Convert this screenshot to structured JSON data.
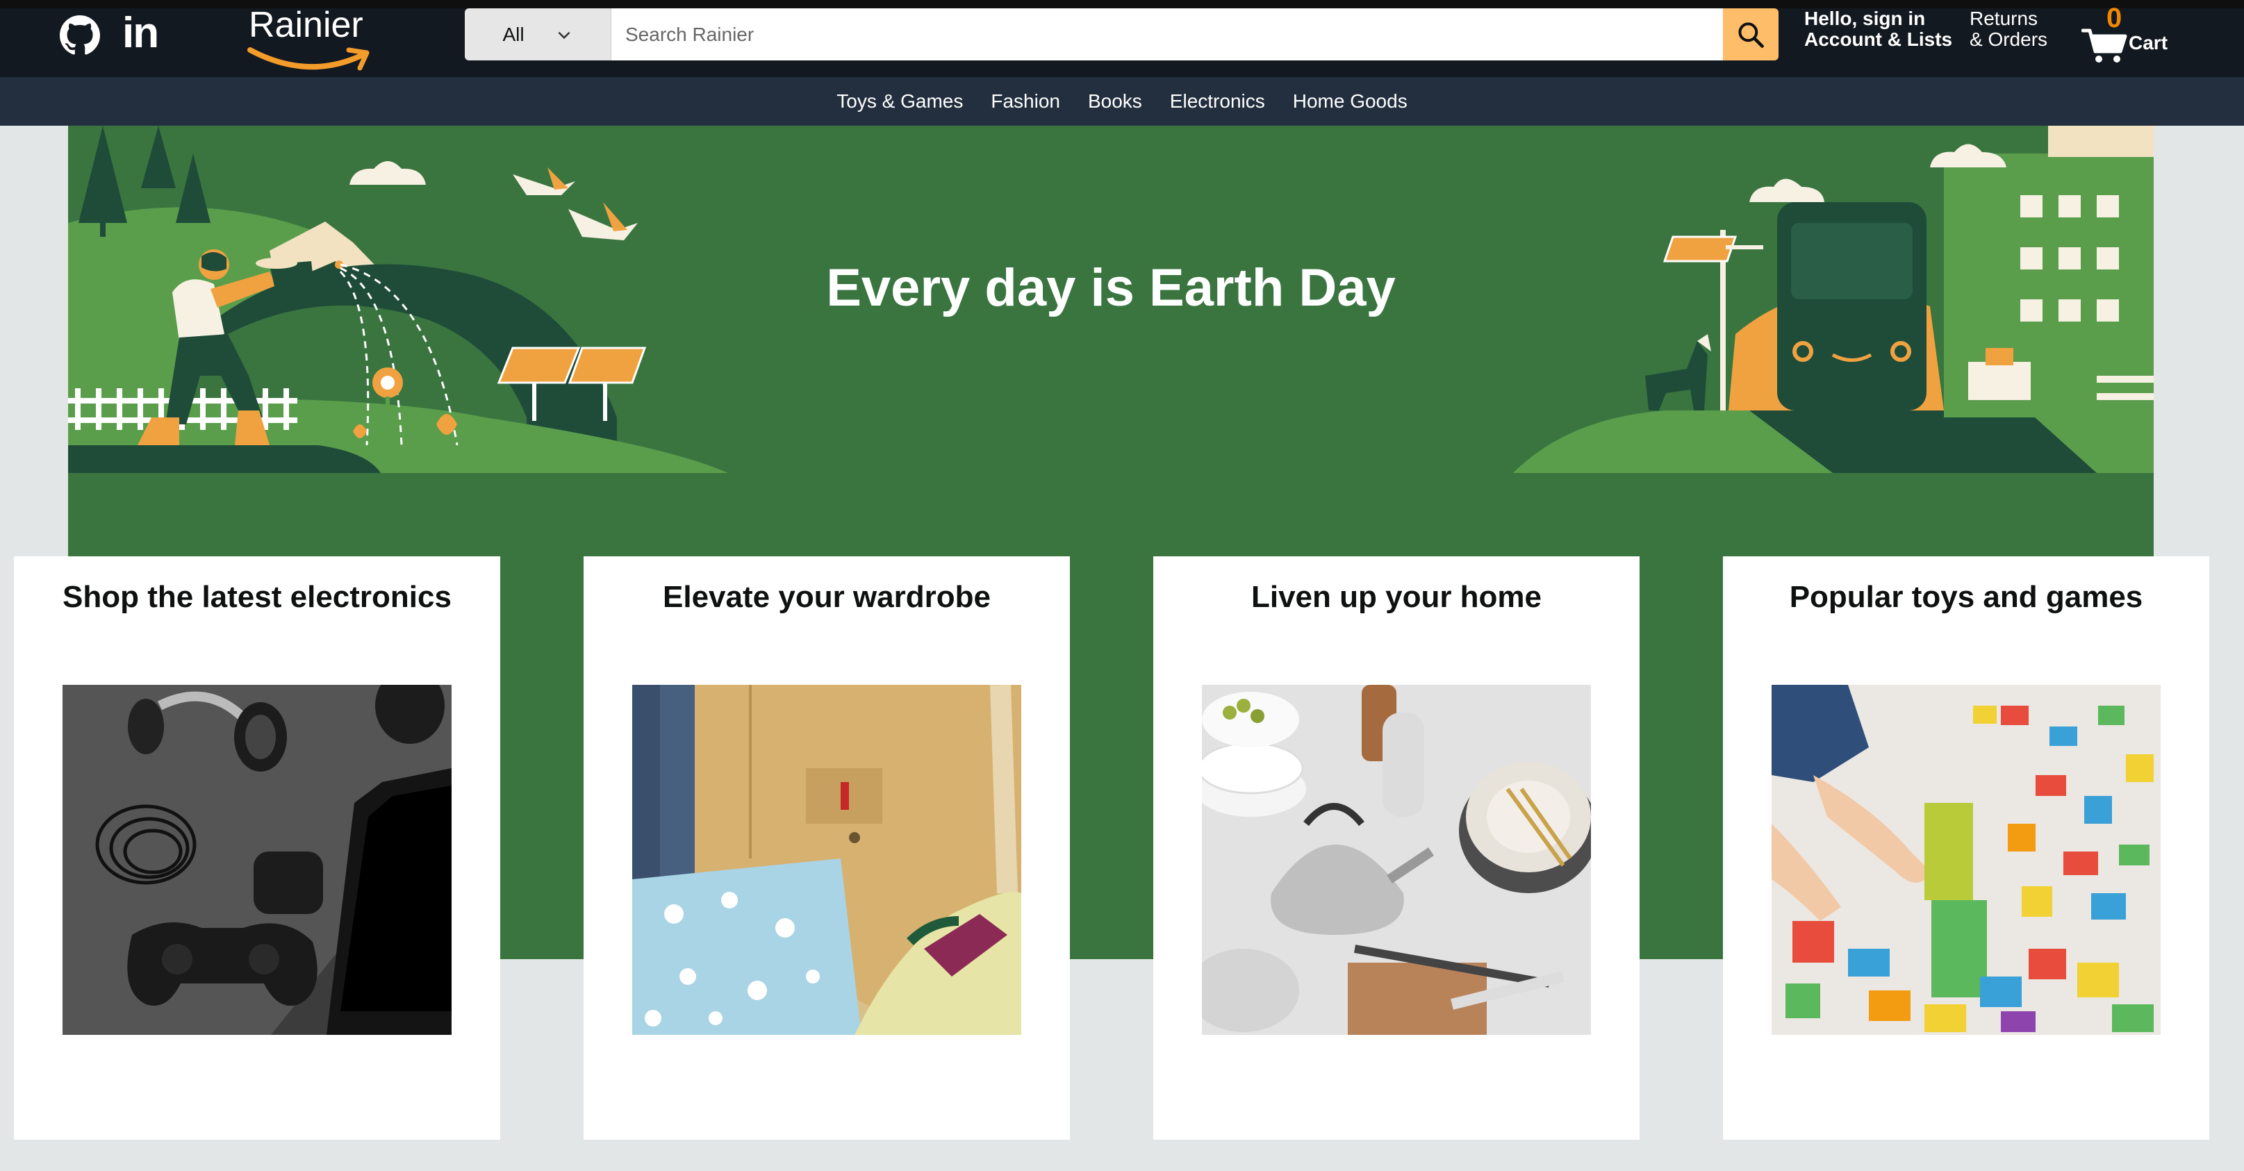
{
  "header": {
    "social": {
      "github_icon": "github-icon",
      "linkedin_label": "in"
    },
    "logo": {
      "text": "Rainier"
    },
    "search": {
      "category": "All",
      "placeholder": "Search Rainier",
      "value": ""
    },
    "account": {
      "line1": "Hello, sign in",
      "line2": "Account & Lists"
    },
    "returns": {
      "line1": "Returns",
      "line2": "& Orders"
    },
    "cart": {
      "count": "0",
      "label": "Cart"
    }
  },
  "nav": {
    "items": [
      {
        "label": "Toys & Games"
      },
      {
        "label": "Fashion"
      },
      {
        "label": "Books"
      },
      {
        "label": "Electronics"
      },
      {
        "label": "Home Goods"
      }
    ]
  },
  "hero": {
    "title": "Every day is Earth Day"
  },
  "cards": [
    {
      "title": "Shop the latest electronics",
      "image": "electronics-image"
    },
    {
      "title": "Elevate your wardrobe",
      "image": "wardrobe-image"
    },
    {
      "title": "Liven up your home",
      "image": "home-image"
    },
    {
      "title": "Popular toys and games",
      "image": "toys-image"
    }
  ],
  "colors": {
    "header_bg": "#131921",
    "nav_bg": "#232f3e",
    "accent": "#febd69",
    "cart_count": "#f08804",
    "hero_green": "#3a7540",
    "page_bg": "#e3e6e6"
  }
}
